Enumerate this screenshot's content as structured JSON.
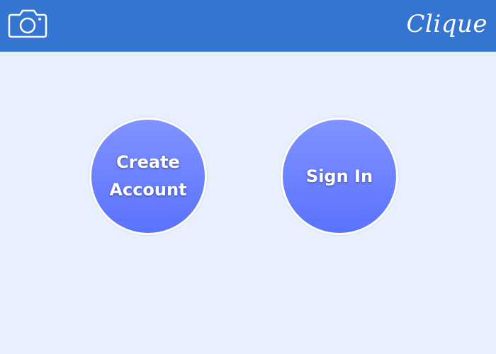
{
  "header": {
    "title": "Clique",
    "camera_icon": "camera-icon",
    "background": "#3375d0"
  },
  "main": {
    "background": "#e8f0fe",
    "create_account_label": "Create\nAccount",
    "sign_in_label": "Sign In",
    "button_gradient_top": "#8093ff",
    "button_gradient_bottom": "#5a72ff"
  }
}
